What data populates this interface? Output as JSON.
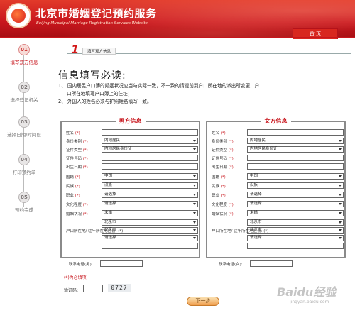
{
  "header": {
    "title": "北京市婚姻登记预约服务",
    "subtitle": "Beijing Municipal Marriage Registration Services Website",
    "home_tab": "首 页"
  },
  "sidebar": {
    "steps": [
      {
        "num": "01",
        "label": "填写双方信息"
      },
      {
        "num": "02",
        "label": "选择登记机关"
      },
      {
        "num": "03",
        "label": "选择日期/时间段"
      },
      {
        "num": "04",
        "label": "打印预约单"
      },
      {
        "num": "05",
        "label": "预约完成"
      }
    ]
  },
  "banner": {
    "num": "1",
    "text": "填写双方信息"
  },
  "notice": {
    "title": "信息填写必读:",
    "line1": "1、 国内居民户口簿的婚姻状况应当与实际一致，不一致的请提前到户口所在地的派出所变更，户",
    "line1b": "口所在地填写户口簿上的住址；",
    "line2": "2、 外国人的姓名必须与护照姓名填写一致。"
  },
  "male": {
    "title": "男方信息",
    "labels": {
      "name": "姓名",
      "region": "身份类别",
      "idtype": "证件类型",
      "idno": "证件号码",
      "birth": "出生日期",
      "nation": "国籍",
      "ethnic": "民族",
      "job": "职业",
      "edu": "文化程度",
      "marital": "婚姻状况",
      "addr": "户口所在地/\n驻年所在地区县:"
    },
    "values": {
      "region": "内地居民",
      "idtype": "内地居民身份证",
      "nation": "中国",
      "ethnic": "汉族",
      "job": "请选择",
      "edu": "请选择",
      "marital": "未婚",
      "addr1": "北京市",
      "addr2": "北京市",
      "addr3": "请选择"
    }
  },
  "female": {
    "title": "女方信息",
    "labels": {
      "name": "姓名",
      "region": "身份类别",
      "idtype": "证件类型",
      "idno": "证件号码",
      "birth": "出生日期",
      "nation": "国籍",
      "ethnic": "民族",
      "job": "职业",
      "edu": "文化程度",
      "marital": "婚姻状况",
      "addr": "户口所在地/\n驻年所在地区县:"
    },
    "values": {
      "region": "内地居民",
      "idtype": "内地居民身份证",
      "nation": "中国",
      "ethnic": "汉族",
      "job": "请选择",
      "edu": "请选择",
      "marital": "未婚",
      "addr1": "北京市",
      "addr2": "北京市",
      "addr3": "请选择"
    }
  },
  "phone": {
    "male_label": "联系电话(男):",
    "female_label": "联系电话(女):"
  },
  "req_note": "(*)为必填项",
  "captcha": {
    "label": "验证码:",
    "code": "0727"
  },
  "next_button": "下一步",
  "watermark": {
    "brand": "Baidu经验",
    "url": "jingyan.baidu.com"
  },
  "colors": {
    "primary": "#c8161d",
    "accent": "#f0a050"
  }
}
